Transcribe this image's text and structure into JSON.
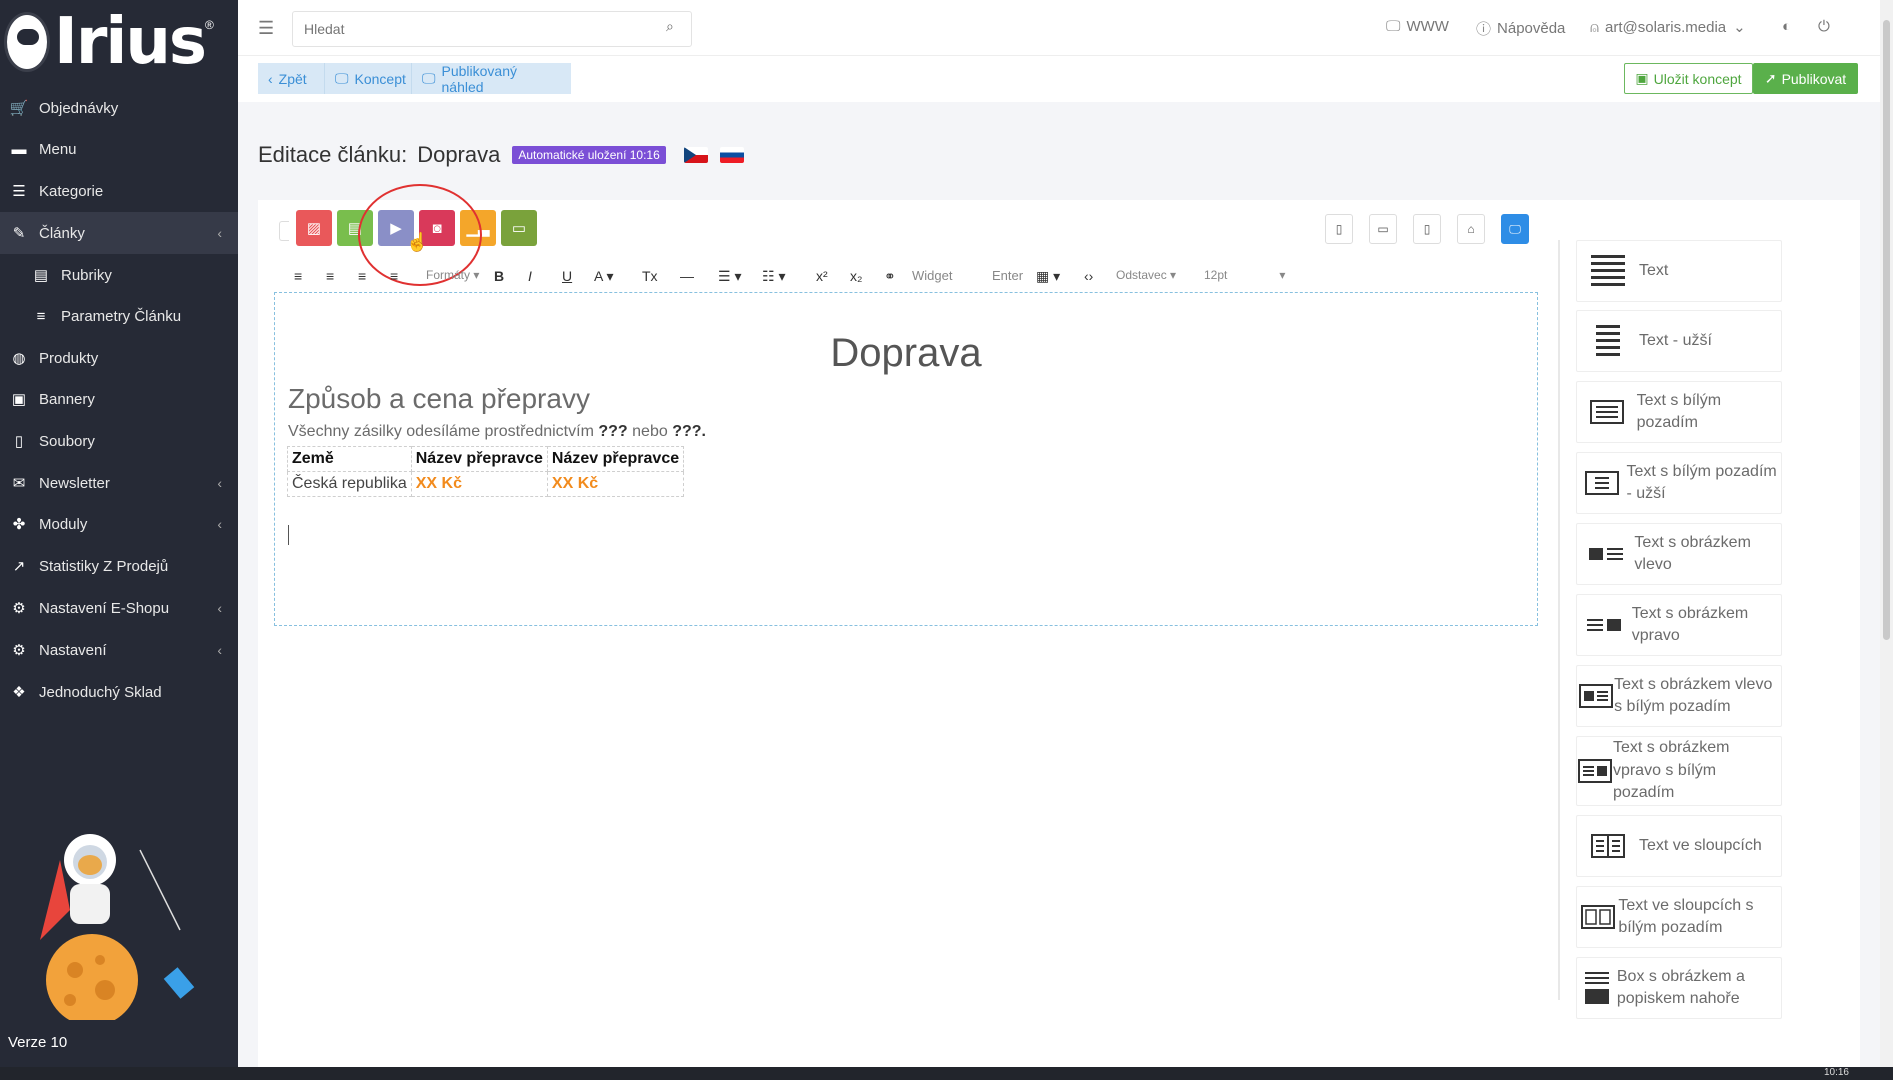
{
  "app": {
    "logo": "Irius",
    "version": "Verze 10"
  },
  "sidebar": {
    "items": [
      {
        "label": "Objednávky",
        "icon": "cart-icon"
      },
      {
        "label": "Menu",
        "icon": "folder-icon"
      },
      {
        "label": "Kategorie",
        "icon": "list-icon"
      },
      {
        "label": "Články",
        "icon": "pencil-icon",
        "active": true,
        "expanded": true
      },
      {
        "label": "Rubriky",
        "icon": "newspaper-icon",
        "sub": true
      },
      {
        "label": "Parametry Článku",
        "icon": "sliders-icon",
        "sub": true
      },
      {
        "label": "Produkty",
        "icon": "basketball-icon"
      },
      {
        "label": "Bannery",
        "icon": "image-icon"
      },
      {
        "label": "Soubory",
        "icon": "file-icon"
      },
      {
        "label": "Newsletter",
        "icon": "mail-icon",
        "arrow": true
      },
      {
        "label": "Moduly",
        "icon": "puzzle-icon",
        "arrow": true
      },
      {
        "label": "Statistiky Z Prodejů",
        "icon": "chart-icon"
      },
      {
        "label": "Nastavení E-Shopu",
        "icon": "cogs-icon",
        "arrow": true
      },
      {
        "label": "Nastavení",
        "icon": "cogs-icon",
        "arrow": true
      },
      {
        "label": "Jednoduchý Sklad",
        "icon": "dropbox-icon"
      }
    ]
  },
  "topbar": {
    "search_placeholder": "Hledat",
    "www": "WWW",
    "help": "Nápověda",
    "user": "art@solaris.media"
  },
  "actions": {
    "back": "Zpět",
    "draft": "Koncept",
    "preview": "Publikovaný náhled",
    "save_draft": "Uložit koncept",
    "publish": "Publikovat"
  },
  "page": {
    "title_prefix": "Editace článku:",
    "title": "Doprava",
    "autosave": "Automatické uložení 10:16"
  },
  "toolbar": {
    "formats": "Formáty",
    "widget": "Widget",
    "enter": "Enter",
    "paragraph": "Odstavec",
    "font_size": "12pt"
  },
  "editor": {
    "h1": "Doprava",
    "h2": "Způsob a cena přepravy",
    "para_text": "Všechny zásilky odesíláme prostřednictvím",
    "para_q1": "???",
    "para_mid": "nebo",
    "para_q2": "???.",
    "table": {
      "headers": [
        "Země",
        "Název přepravce",
        "Název přepravce"
      ],
      "rows": [
        [
          "Česká republika",
          "XX Kč",
          "XX Kč"
        ]
      ]
    }
  },
  "blocks": [
    "Text",
    "Text - užší",
    "Text s bílým pozadím",
    "Text s bílým pozadím - užší",
    "Text s obrázkem vlevo",
    "Text s obrázkem vpravo",
    "Text s obrázkem vlevo s bílým pozadím",
    "Text s obrázkem vpravo s bílým pozadím",
    "Text ve sloupcích",
    "Text ve sloupcích s bílým pozadím",
    "Box s obrázkem a popiskem nahoře"
  ],
  "colors": {
    "sidebar": "#262a36",
    "accent": "#2e8de6",
    "publish": "#5ab04b",
    "autosave": "#7b4fd6",
    "highlight": "#e03131"
  },
  "clock": "10:16"
}
